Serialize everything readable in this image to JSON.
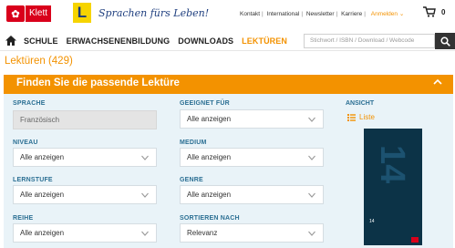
{
  "header": {
    "brand": "Klett",
    "slogan": "Sprachen fürs Leben!",
    "links": [
      "Kontakt",
      "International",
      "Newsletter",
      "Karriere"
    ],
    "login": "Anmelden",
    "cart_count": "0"
  },
  "nav": {
    "items": [
      "SCHULE",
      "ERWACHSENENBILDUNG",
      "DOWNLOADS",
      "LEKTÜREN"
    ],
    "active": "LEKTÜREN",
    "search_placeholder": "Stichwort / ISBN / Download / Webcode"
  },
  "page": {
    "title": "Lektüren (429)",
    "filter_header": "Finden Sie die passende Lektüre"
  },
  "filters": {
    "sprache": {
      "label": "SPRACHE",
      "value": "Französisch"
    },
    "geeignet": {
      "label": "GEEIGNET FÜR",
      "value": "Alle anzeigen"
    },
    "niveau": {
      "label": "NIVEAU",
      "value": "Alle anzeigen"
    },
    "medium": {
      "label": "MEDIUM",
      "value": "Alle anzeigen"
    },
    "lernstufe": {
      "label": "LERNSTUFE",
      "value": "Alle anzeigen"
    },
    "genre": {
      "label": "GENRE",
      "value": "Alle anzeigen"
    },
    "reihe": {
      "label": "REIHE",
      "value": "Alle anzeigen"
    },
    "sortieren": {
      "label": "SORTIEREN NACH",
      "value": "Relevanz"
    }
  },
  "view": {
    "label": "ANSICHT",
    "option": "Liste"
  },
  "colors": {
    "accent": "#f39200",
    "label_blue": "#2b6f93",
    "panel": "#e9f3f8",
    "brand_red": "#d9001b"
  },
  "cover": {
    "big_number": "14"
  }
}
